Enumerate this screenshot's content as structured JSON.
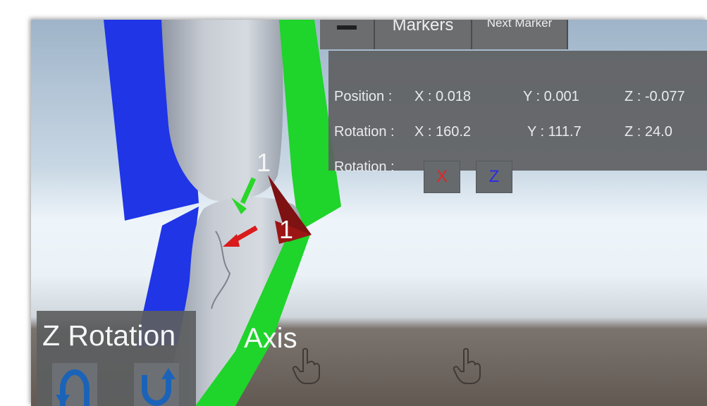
{
  "tabs": {
    "markers_label": "Markers",
    "next_marker_label": "Next Marker"
  },
  "info": {
    "position": {
      "label": "Position :",
      "x": "X : 0.018",
      "y": "Y : 0.001",
      "z": "Z : -0.077"
    },
    "rotation": {
      "label": "Rotation :",
      "x": "X : 160.2",
      "y": "Y : 111.7",
      "z": "Z : 24.0"
    },
    "rotation_axis": {
      "label": "Rotation :",
      "x_button": "X",
      "z_button": "Z"
    }
  },
  "scene": {
    "marker_label_1": "1",
    "marker_label_2": "1",
    "axis_label": "Axis"
  },
  "z_rotation": {
    "title": "Z Rotation"
  },
  "colors": {
    "blue_plane": "#1f35e6",
    "green_plane": "#1fd42b",
    "marker_red": "#7e1111",
    "x_text": "#e02626",
    "z_text": "#2a2ae6",
    "rotate_arrow": "#1b63b8"
  },
  "icons": [
    "menu-icon",
    "rotate-ccw-icon",
    "rotate-cw-icon",
    "hand-cursor-icon"
  ]
}
